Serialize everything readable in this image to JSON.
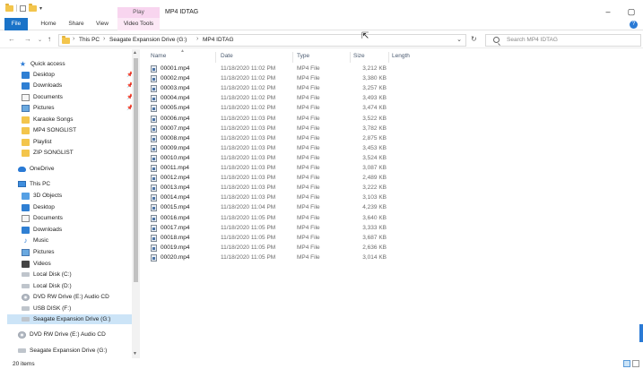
{
  "titlebar": {
    "context_tab": "Play",
    "window_title": "MP4 IDTAG",
    "buttons": [
      "–",
      "▢"
    ]
  },
  "ribbon": {
    "tabs": [
      "File",
      "Home",
      "Share",
      "View",
      "Video Tools"
    ],
    "help_icon": "?"
  },
  "address": {
    "back": "←",
    "forward": "→",
    "recent": "⌄",
    "up": "↑",
    "crumb_sep": "›",
    "crumbs": [
      "This PC",
      "Seagate Expansion Drive (G:)",
      "MP4 IDTAG"
    ],
    "dropdown": "⌄",
    "refresh": "↻",
    "search_placeholder": "Search MP4 IDTAG"
  },
  "nav": {
    "pin_glyph": "📌",
    "items": [
      {
        "label": "Quick access",
        "icon": "star-icon"
      },
      {
        "label": "Desktop",
        "icon": "desktop-icon"
      },
      {
        "label": "Downloads",
        "icon": "downloads-icon"
      },
      {
        "label": "Documents",
        "icon": "documents-icon"
      },
      {
        "label": "Pictures",
        "icon": "pictures-icon"
      },
      {
        "label": "Karaoke Songs",
        "icon": "folder-icon"
      },
      {
        "label": "MP4 SONGLIST",
        "icon": "folder-icon"
      },
      {
        "label": "Playlist",
        "icon": "folder-icon"
      },
      {
        "label": "ZIP SONGLIST",
        "icon": "folder-icon"
      },
      {
        "label": "OneDrive",
        "icon": "cloud-icon"
      },
      {
        "label": "This PC",
        "icon": "pc-icon"
      },
      {
        "label": "3D Objects",
        "icon": "objects-3d-icon"
      },
      {
        "label": "Desktop",
        "icon": "desktop-icon"
      },
      {
        "label": "Documents",
        "icon": "documents-icon"
      },
      {
        "label": "Downloads",
        "icon": "downloads-icon"
      },
      {
        "label": "Music",
        "icon": "music-icon"
      },
      {
        "label": "Pictures",
        "icon": "pictures-icon"
      },
      {
        "label": "Videos",
        "icon": "videos-icon"
      },
      {
        "label": "Local Disk (C:)",
        "icon": "disk-icon"
      },
      {
        "label": "Local Disk (D:)",
        "icon": "disk-icon"
      },
      {
        "label": "DVD RW Drive (E:) Audio CD",
        "icon": "dvd-icon"
      },
      {
        "label": "USB DISK (F:)",
        "icon": "disk-icon"
      },
      {
        "label": "Seagate Expansion Drive (G:)",
        "icon": "disk-icon"
      },
      {
        "label": "DVD RW Drive (E:) Audio CD",
        "icon": "dvd-icon"
      },
      {
        "label": "Seagate Expansion Drive (G:)",
        "icon": "disk-icon"
      }
    ]
  },
  "columns": [
    "Name",
    "Date",
    "Type",
    "Size",
    "Length"
  ],
  "files": [
    {
      "name": "00001.mp4",
      "date": "11/18/2020 11:02 PM",
      "type": "MP4 File",
      "size": "3,212 KB"
    },
    {
      "name": "00002.mp4",
      "date": "11/18/2020 11:02 PM",
      "type": "MP4 File",
      "size": "3,380 KB"
    },
    {
      "name": "00003.mp4",
      "date": "11/18/2020 11:02 PM",
      "type": "MP4 File",
      "size": "3,257 KB"
    },
    {
      "name": "00004.mp4",
      "date": "11/18/2020 11:02 PM",
      "type": "MP4 File",
      "size": "3,493 KB"
    },
    {
      "name": "00005.mp4",
      "date": "11/18/2020 11:02 PM",
      "type": "MP4 File",
      "size": "3,474 KB"
    },
    {
      "name": "00006.mp4",
      "date": "11/18/2020 11:03 PM",
      "type": "MP4 File",
      "size": "3,522 KB"
    },
    {
      "name": "00007.mp4",
      "date": "11/18/2020 11:03 PM",
      "type": "MP4 File",
      "size": "3,782 KB"
    },
    {
      "name": "00008.mp4",
      "date": "11/18/2020 11:03 PM",
      "type": "MP4 File",
      "size": "2,875 KB"
    },
    {
      "name": "00009.mp4",
      "date": "11/18/2020 11:03 PM",
      "type": "MP4 File",
      "size": "3,453 KB"
    },
    {
      "name": "00010.mp4",
      "date": "11/18/2020 11:03 PM",
      "type": "MP4 File",
      "size": "3,524 KB"
    },
    {
      "name": "00011.mp4",
      "date": "11/18/2020 11:03 PM",
      "type": "MP4 File",
      "size": "3,087 KB"
    },
    {
      "name": "00012.mp4",
      "date": "11/18/2020 11:03 PM",
      "type": "MP4 File",
      "size": "2,489 KB"
    },
    {
      "name": "00013.mp4",
      "date": "11/18/2020 11:03 PM",
      "type": "MP4 File",
      "size": "3,222 KB"
    },
    {
      "name": "00014.mp4",
      "date": "11/18/2020 11:03 PM",
      "type": "MP4 File",
      "size": "3,103 KB"
    },
    {
      "name": "00015.mp4",
      "date": "11/18/2020 11:04 PM",
      "type": "MP4 File",
      "size": "4,239 KB"
    },
    {
      "name": "00016.mp4",
      "date": "11/18/2020 11:05 PM",
      "type": "MP4 File",
      "size": "3,640 KB"
    },
    {
      "name": "00017.mp4",
      "date": "11/18/2020 11:05 PM",
      "type": "MP4 File",
      "size": "3,333 KB"
    },
    {
      "name": "00018.mp4",
      "date": "11/18/2020 11:05 PM",
      "type": "MP4 File",
      "size": "3,687 KB"
    },
    {
      "name": "00019.mp4",
      "date": "11/18/2020 11:05 PM",
      "type": "MP4 File",
      "size": "2,636 KB"
    },
    {
      "name": "00020.mp4",
      "date": "11/18/2020 11:05 PM",
      "type": "MP4 File",
      "size": "3,014 KB"
    }
  ],
  "status": {
    "item_count": "20 items"
  },
  "colors": {
    "accent": "#1a73c8",
    "context_tab": "#f8d5ef",
    "selection": "#cce4f7"
  }
}
